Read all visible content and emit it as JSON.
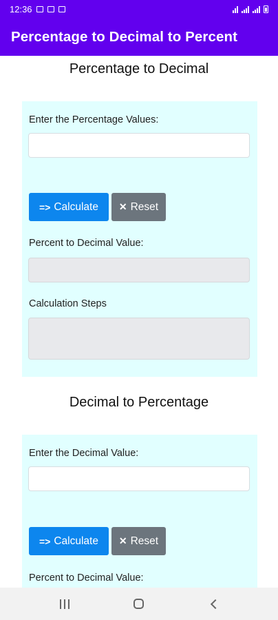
{
  "status_bar": {
    "time": "12:36"
  },
  "app_bar": {
    "title": "Percentage to Decimal to Percent"
  },
  "sections": [
    {
      "title": "Percentage to Decimal",
      "input_label": "Enter the Percentage Values:",
      "input_value": "",
      "calculate_label": "Calculate",
      "calculate_icon": "=>",
      "reset_label": "Reset",
      "reset_icon": "✕",
      "result_label": "Percent to Decimal Value:",
      "steps_label": "Calculation Steps"
    },
    {
      "title": "Decimal to Percentage",
      "input_label": "Enter the Decimal Value:",
      "input_value": "",
      "calculate_label": "Calculate",
      "calculate_icon": "=>",
      "reset_label": "Reset",
      "reset_icon": "✕",
      "result_label": "Percent to Decimal Value:"
    }
  ],
  "nav_bar": {
    "recent_icon": "recent-apps-icon",
    "home_icon": "home-icon",
    "back_icon": "back-icon"
  }
}
